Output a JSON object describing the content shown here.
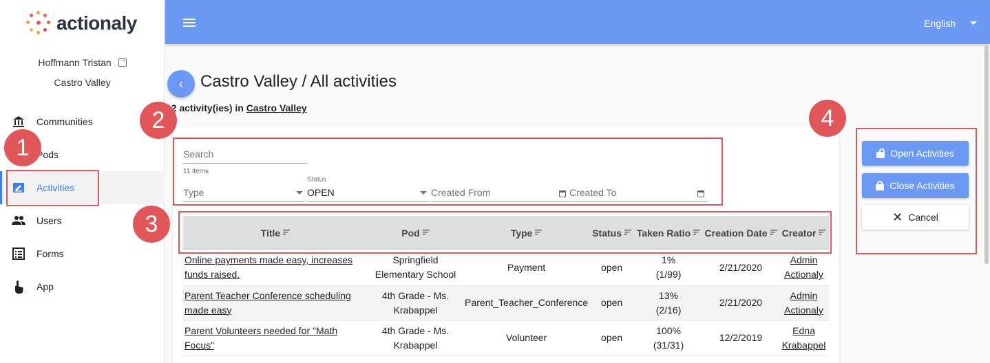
{
  "app": {
    "logo_text": "actionaly",
    "brand_color": "#6c99f3",
    "annotation_color": "#e15658"
  },
  "user": {
    "name": "Hoffmann Tristan",
    "community": "Castro Valley"
  },
  "nav": {
    "items": [
      {
        "label": "Communities",
        "icon": "bank-icon"
      },
      {
        "label": "Pods",
        "icon": "pods-icon"
      },
      {
        "label": "Activities",
        "icon": "activity-icon",
        "active": true
      },
      {
        "label": "Users",
        "icon": "users-icon"
      },
      {
        "label": "Forms",
        "icon": "list-icon"
      },
      {
        "label": "App",
        "icon": "touch-icon"
      }
    ]
  },
  "topbar": {
    "language": "English"
  },
  "page": {
    "title": "Castro Valley / All activities",
    "count_text": "12 activity(ies) in",
    "count_link": "Castro Valley"
  },
  "filters": {
    "search_placeholder": "Search",
    "items_count": "11 items",
    "type_placeholder": "Type",
    "status_label": "Status",
    "status_value": "OPEN",
    "created_from_placeholder": "Created From",
    "created_to_placeholder": "Created To"
  },
  "table": {
    "columns": [
      "Title",
      "Pod",
      "Type",
      "Status",
      "Taken Ratio",
      "Creation Date",
      "Creator"
    ],
    "rows": [
      {
        "title": "Online payments made easy, increases funds raised.",
        "pod": "Springfield Elementary School",
        "type": "Payment",
        "status": "open",
        "ratio_pct": "1%",
        "ratio_frac": "(1/99)",
        "date": "2/21/2020",
        "creator_first": "Admin",
        "creator_last": "Actionaly"
      },
      {
        "title": "Parent Teacher Conference scheduling made easy",
        "pod": "4th Grade - Ms. Krabappel",
        "type": "Parent_Teacher_Conference",
        "status": "open",
        "ratio_pct": "13%",
        "ratio_frac": "(2/16)",
        "date": "2/21/2020",
        "creator_first": "Admin",
        "creator_last": "Actionaly"
      },
      {
        "title": "Parent Volunteers needed for \"Math Focus\"",
        "pod": "4th Grade - Ms. Krabappel",
        "type": "Volunteer",
        "status": "open",
        "ratio_pct": "100%",
        "ratio_frac": "(31/31)",
        "date": "12/2/2019",
        "creator_first": "Edna",
        "creator_last": "Krabappel"
      }
    ]
  },
  "actions": {
    "open_label": "Open Activities",
    "close_label": "Close Activities",
    "cancel_label": "Cancel"
  },
  "annotations": [
    "1",
    "2",
    "3",
    "4"
  ]
}
